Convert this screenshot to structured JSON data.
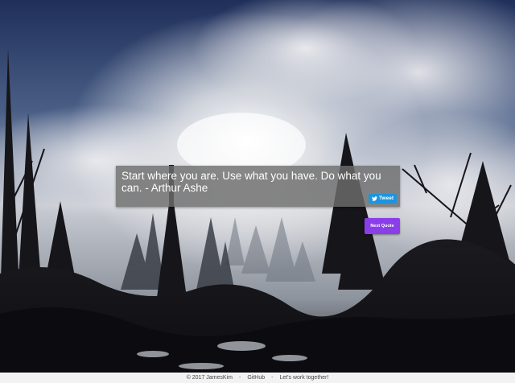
{
  "quote": {
    "text": "Start where you are. Use what you have. Do what you can. - Arthur Ashe"
  },
  "buttons": {
    "tweet_label": "Tweet",
    "next_label": "Next Quote"
  },
  "footer": {
    "copyright": "© 2017 JamesKim",
    "separator": "-",
    "github_label": "GitHub",
    "contact_label": "Let's work together!"
  },
  "colors": {
    "quote_box_bg": "#6e6e6e",
    "tweet_button": "#1b95e0",
    "next_button": "#8a3ee8",
    "footer_bg": "#f2f2f2"
  }
}
